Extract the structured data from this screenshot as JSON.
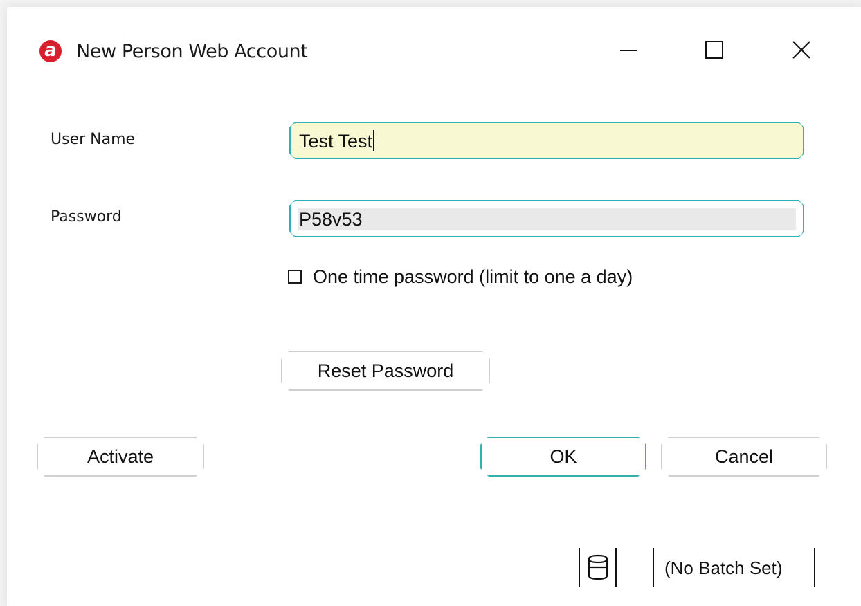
{
  "window": {
    "title": "New Person Web Account",
    "logo_letter": "a",
    "controls": {
      "minimize": "minimize-icon",
      "maximize": "maximize-icon",
      "close": "close-icon"
    }
  },
  "form": {
    "user_name_label": "User Name",
    "user_name_value": "Test Test",
    "password_label": "Password",
    "password_value": "P58v53",
    "one_time_password_label": "One time password (limit to one a day)",
    "one_time_password_checked": false
  },
  "buttons": {
    "reset_password": "Reset Password",
    "activate": "Activate",
    "ok": "OK",
    "cancel": "Cancel"
  },
  "status_bar": {
    "database_icon": "database-icon",
    "batch": "(No Batch Set)"
  },
  "colors": {
    "accent": "#2fb2b6",
    "logo": "#d6202e",
    "user_field_bg": "#f8f8d3",
    "password_field_bg": "#e9e9e9",
    "button_border": "#cfcfcf"
  }
}
